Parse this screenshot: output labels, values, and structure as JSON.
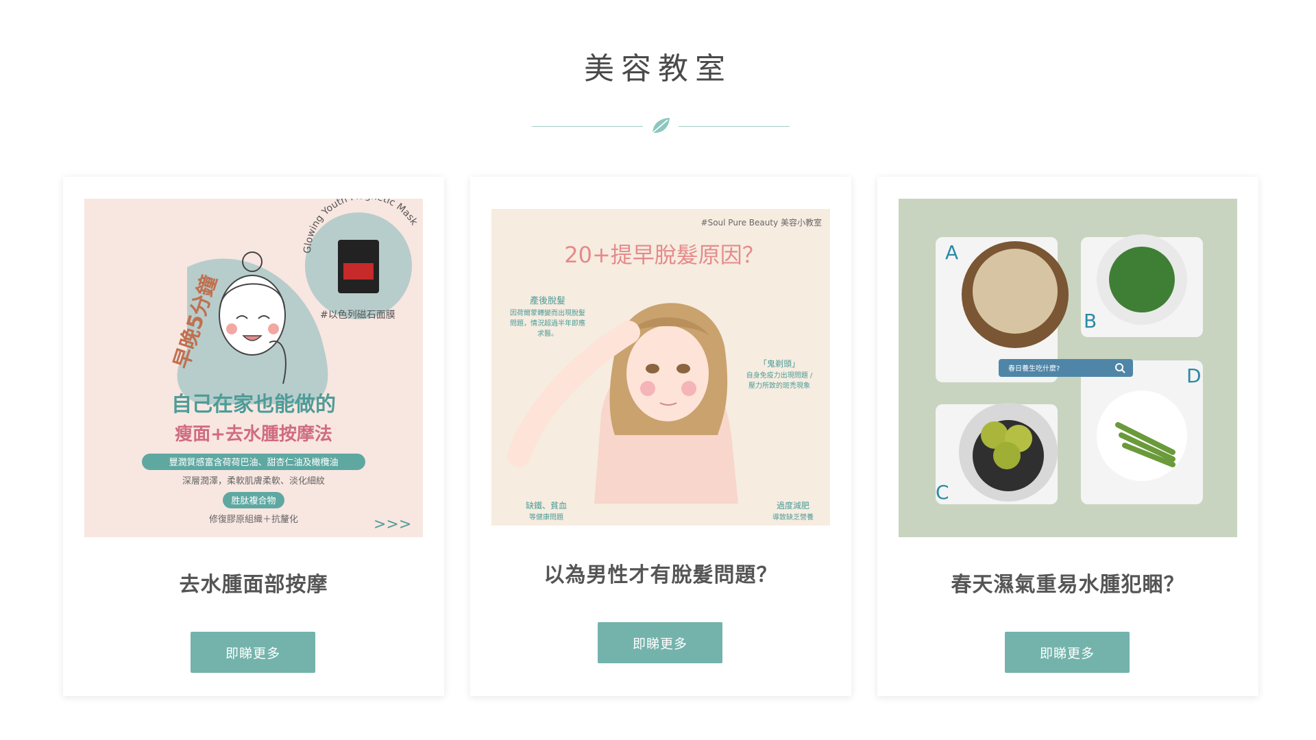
{
  "section": {
    "title": "美容教室"
  },
  "colors": {
    "accent": "#74b3ac",
    "divider": "#9fcbc5",
    "title": "#4a4a4a"
  },
  "cards": [
    {
      "title": "去水腫面部按摩",
      "button": "即睇更多",
      "image": {
        "curved_text": "Glowing Youth Magnetic Mask",
        "side_title": "早晚5分鐘",
        "tag": "#以色列磁石面膜",
        "headline1": "自己在家也能做的",
        "headline2": "瘦面+去水腫按摩法",
        "pill1": "豐潤質感富含荷荷巴油、甜杏仁油及橄欖油",
        "line1": "深層潤澤，柔軟肌膚柔軟、淡化細紋",
        "pill2": "胜肽複合物",
        "line2": "修復膠原組織＋抗釐化",
        "arrows": ">>>"
      }
    },
    {
      "title": "以為男性才有脫髮問題？",
      "button": "即睇更多",
      "image": {
        "header_tag": "#Soul Pure Beauty 美容小教室",
        "headline": "20+提早脫髮原因？",
        "note1_title": "產後脫髮",
        "note1_l1": "因荷爾蒙轉變而出現脫髮",
        "note1_l2": "問題，情況超過半年即應",
        "note1_l3": "求醫。",
        "note2_title": "「鬼剃頭」",
        "note2_l1": "自身免疫力出現問題 /",
        "note2_l2": "壓力所致的斑禿現象",
        "note3_title": "缺鐵、貧血",
        "note3_l1": "等健康問題",
        "note4_title": "過度減肥",
        "note4_l1": "導致缺乏營養"
      }
    },
    {
      "title": "春天濕氣重易水腫犯睏？",
      "button": "即睇更多",
      "image": {
        "search_text": "春日養生吃什麼?",
        "letter_a": "A",
        "letter_b": "B",
        "letter_c": "C",
        "letter_d": "D"
      }
    }
  ]
}
